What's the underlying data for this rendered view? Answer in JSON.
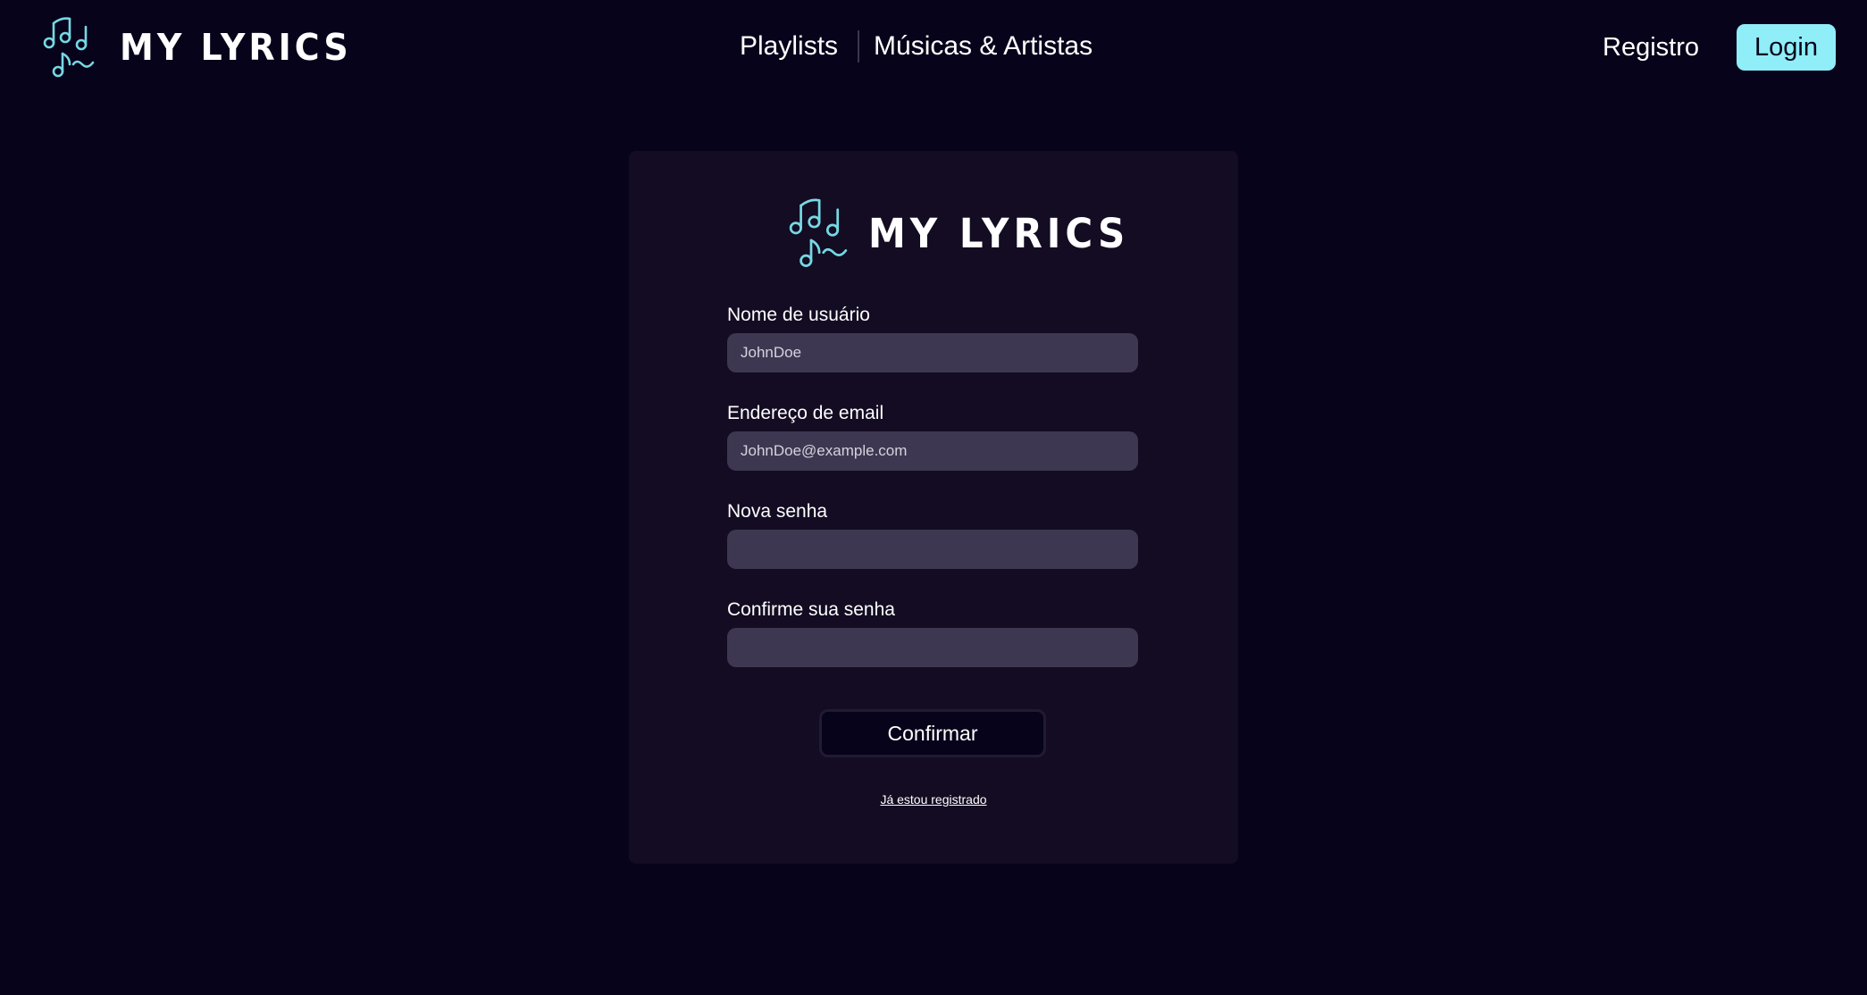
{
  "brand": {
    "name": "MY LYRICS",
    "icon": "music-notes-icon",
    "accent_color": "#8feef8"
  },
  "header": {
    "nav": {
      "playlists_label": "Playlists",
      "songs_artists_label": "Músicas & Artistas"
    },
    "register_label": "Registro",
    "login_label": "Login"
  },
  "form": {
    "username": {
      "label": "Nome de usuário",
      "placeholder": "JohnDoe",
      "value": ""
    },
    "email": {
      "label": "Endereço de email",
      "placeholder": "JohnDoe@example.com",
      "value": ""
    },
    "password": {
      "label": "Nova senha",
      "value": ""
    },
    "confirm_password": {
      "label": "Confirme sua senha",
      "value": ""
    },
    "submit_label": "Confirmar",
    "already_registered_label": "Já estou registrado"
  },
  "colors": {
    "background": "#07031a",
    "card": "#130c22",
    "input": "#3e3751"
  }
}
